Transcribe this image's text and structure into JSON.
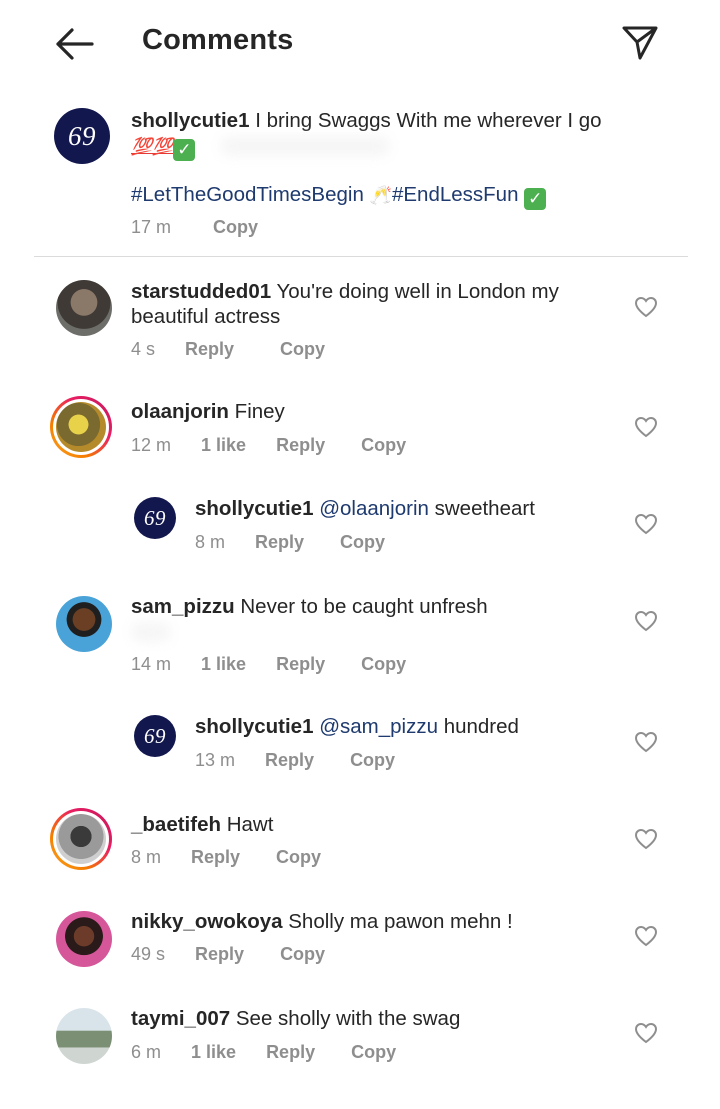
{
  "header": {
    "title": "Comments"
  },
  "caption": {
    "username": "shollycutie1",
    "text_line1": "I bring Swaggs With me wherever I go",
    "emoji_hundreds": "💯💯",
    "hashtag1": "#LetTheGoodTimesBegin",
    "hashtag2": "#EndLessFun",
    "time": "17 m",
    "copy": "Copy",
    "avatar_text": "69"
  },
  "comments": [
    {
      "username": "starstudded01",
      "text_line1": "You're doing well in London my",
      "text_line2": "beautiful actress",
      "time": "4 s",
      "reply": "Reply",
      "copy": "Copy"
    },
    {
      "username": "olaanjorin",
      "text": "Finey",
      "time": "12 m",
      "likes": "1 like",
      "reply": "Reply",
      "copy": "Copy"
    },
    {
      "username": "shollycutie1",
      "mention": "@olaanjorin",
      "text": "sweetheart",
      "time": "8 m",
      "reply": "Reply",
      "copy": "Copy",
      "avatar_text": "69"
    },
    {
      "username": "sam_pizzu",
      "text": "Never to be caught unfresh",
      "time": "14 m",
      "likes": "1 like",
      "reply": "Reply",
      "copy": "Copy"
    },
    {
      "username": "shollycutie1",
      "mention": "@sam_pizzu",
      "text": "hundred",
      "time": "13 m",
      "reply": "Reply",
      "copy": "Copy",
      "avatar_text": "69"
    },
    {
      "username": "_baetifeh",
      "text": "Hawt",
      "time": "8 m",
      "reply": "Reply",
      "copy": "Copy"
    },
    {
      "username": "nikky_owokoya",
      "text": "Sholly ma pawon mehn !",
      "time": "49 s",
      "reply": "Reply",
      "copy": "Copy"
    },
    {
      "username": "taymi_007",
      "text": "See sholly with the swag",
      "time": "6 m",
      "likes": "1 like",
      "reply": "Reply",
      "copy": "Copy"
    }
  ],
  "colors": {
    "mention": "#1e3a6e",
    "avatar_navy": "#12174e",
    "meta_gray": "#8e8e8e"
  }
}
